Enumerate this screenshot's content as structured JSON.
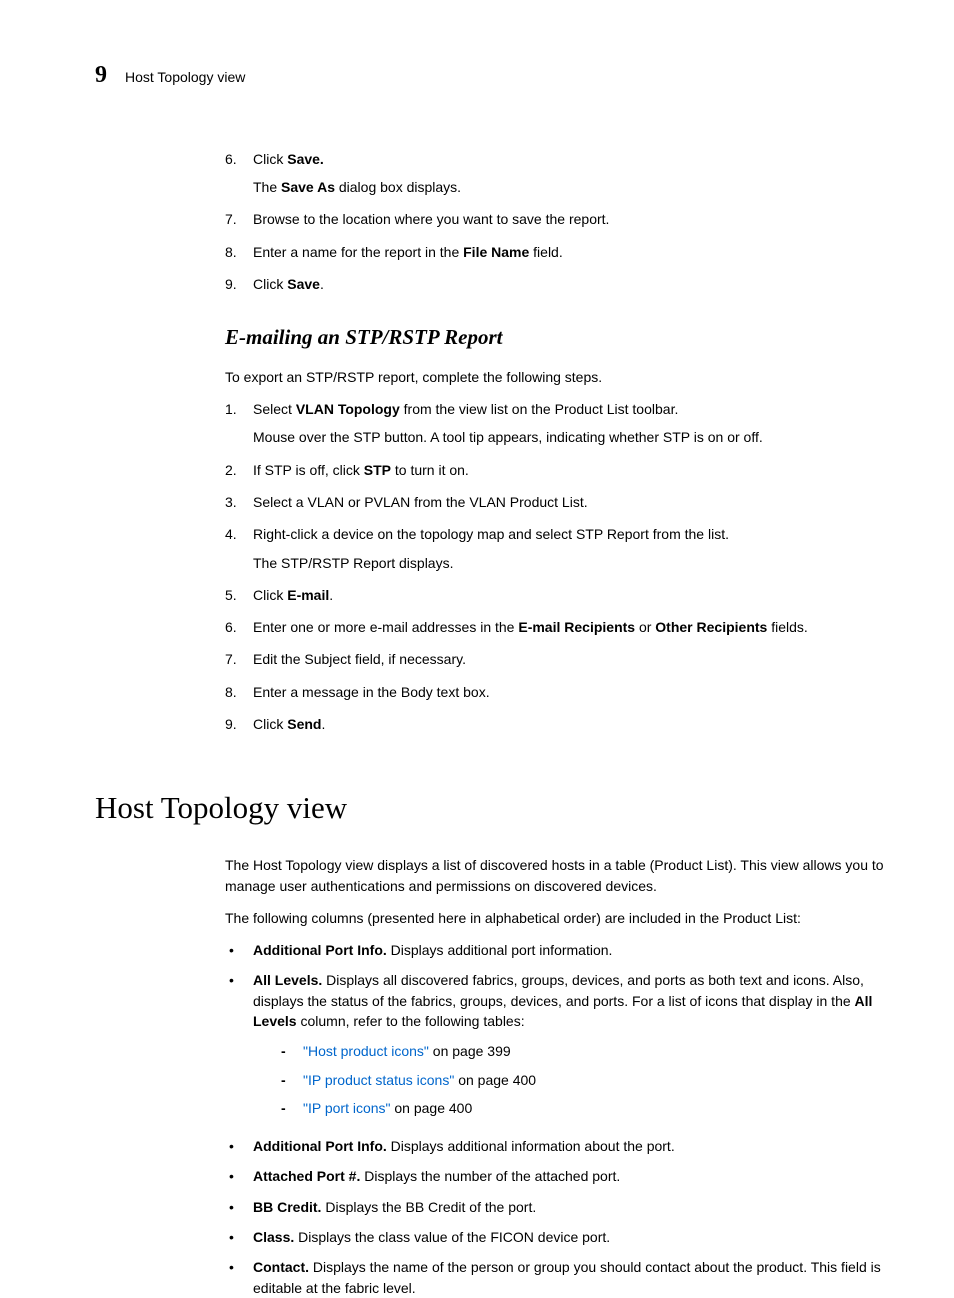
{
  "header": {
    "chapter_number": "9",
    "chapter_title": "Host Topology view"
  },
  "steps_first": [
    {
      "n": "6.",
      "text_pre": "Click ",
      "bold": "Save.",
      "text_post": "",
      "sub_pre": "The ",
      "sub_bold": "Save As",
      "sub_post": " dialog box displays."
    },
    {
      "n": "7.",
      "text": "Browse to the location where you want to save the report."
    },
    {
      "n": "8.",
      "text_pre": "Enter a name for the report in the ",
      "bold": "File Name",
      "text_post": " field."
    },
    {
      "n": "9.",
      "text_pre": "Click ",
      "bold": "Save",
      "text_post": "."
    }
  ],
  "section": {
    "title": "E-mailing an STP/RSTP Report",
    "intro": "To export an STP/RSTP report, complete the following steps."
  },
  "steps_email": [
    {
      "n": "1.",
      "pre": "Select ",
      "bold": "VLAN Topology",
      "post": " from the view list on the Product List toolbar.",
      "sub": "Mouse over the STP button. A tool tip appears, indicating whether STP is on or off."
    },
    {
      "n": "2.",
      "pre": "If STP is off, click ",
      "bold": "STP",
      "post": " to turn it on."
    },
    {
      "n": "3.",
      "text": "Select a VLAN or PVLAN from the VLAN Product List."
    },
    {
      "n": "4.",
      "text": "Right-click a device on the topology map and select STP Report from the list.",
      "sub": "The STP/RSTP Report displays."
    },
    {
      "n": "5.",
      "pre": "Click ",
      "bold": "E-mail",
      "post": "."
    },
    {
      "n": "6.",
      "pre": "Enter one or more e-mail addresses in the ",
      "bold": "E-mail Recipients",
      "mid": " or ",
      "bold2": "Other Recipients",
      "post2": " fields."
    },
    {
      "n": "7.",
      "text": "Edit the Subject field, if necessary."
    },
    {
      "n": "8.",
      "text": "Enter a message in the Body text box."
    },
    {
      "n": "9.",
      "pre": "Click ",
      "bold": "Send",
      "post": "."
    }
  ],
  "main": {
    "heading": "Host Topology view",
    "para1": "The Host Topology view displays a list of discovered hosts in a table (Product List). This view allows you to manage user authentications and permissions on discovered devices.",
    "para2": "The following columns (presented here in alphabetical order) are included in the Product List:"
  },
  "bullets": [
    {
      "bold": "Additional Port Info.",
      "rest": " Displays additional port information."
    },
    {
      "bold": "All Levels.",
      "rest": " Displays all discovered fabrics, groups, devices, and ports as both text and icons. Also, displays the status of the fabrics, groups, devices, and ports. For a list of icons that display in the ",
      "bold2": "All Levels",
      "rest2": " column, refer to the following tables:",
      "dashes": [
        {
          "link": "\"Host product icons\"",
          "after": " on page 399"
        },
        {
          "link": "\"IP product status icons\"",
          "after": " on page 400"
        },
        {
          "link": "\"IP port icons\"",
          "after": " on page 400"
        }
      ]
    },
    {
      "bold": "Additional Port Info.",
      "rest": " Displays additional information about the port."
    },
    {
      "bold": "Attached Port #.",
      "rest": " Displays the number of the attached port."
    },
    {
      "bold": "BB Credit.",
      "rest": " Displays the BB Credit of the port."
    },
    {
      "bold": "Class.",
      "rest": " Displays the class value of the FICON device port."
    },
    {
      "bold": "Contact.",
      "rest": " Displays the name of the person or group you should contact about the product. This field is editable at the fabric level."
    }
  ]
}
